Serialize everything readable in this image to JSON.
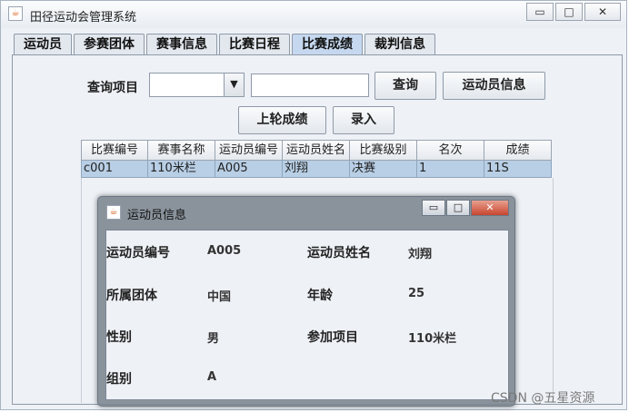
{
  "window": {
    "title": "田径运动会管理系统",
    "icon": "java-cup-icon"
  },
  "window_controls": {
    "minimize": "▭",
    "maximize": "□",
    "close": "✕"
  },
  "tabs": [
    {
      "label": "运动员"
    },
    {
      "label": "参赛团体"
    },
    {
      "label": "赛事信息"
    },
    {
      "label": "比赛日程"
    },
    {
      "label": "比赛成绩",
      "active": true
    },
    {
      "label": "裁判信息"
    }
  ],
  "query": {
    "label": "查询项目",
    "combo_value": "",
    "text_value": "",
    "query_button": "查询",
    "athlete_info_button": "运动员信息",
    "prev_round_button": "上轮成绩",
    "enter_button": "录入"
  },
  "table": {
    "columns": [
      "比赛编号",
      "赛事名称",
      "运动员编号",
      "运动员姓名",
      "比赛级别",
      "名次",
      "成绩"
    ],
    "rows": [
      [
        "c001",
        "110米栏",
        "A005",
        "刘翔",
        "决赛",
        "1",
        "11S"
      ]
    ]
  },
  "dialog": {
    "title": "运动员信息",
    "fields": {
      "athlete_id_label": "运动员编号",
      "athlete_id_value": "A005",
      "athlete_name_label": "运动员姓名",
      "athlete_name_value": "刘翔",
      "team_label": "所属团体",
      "team_value": "中国",
      "age_label": "年龄",
      "age_value": "25",
      "gender_label": "性别",
      "gender_value": "男",
      "event_label": "参加项目",
      "event_value": "110米栏",
      "group_label": "组别",
      "group_value": "A"
    }
  },
  "watermark": "CSDN @五星资源",
  "colors": {
    "selected_row": "#b8cfe5",
    "active_tab": "#c5d8ef",
    "dialog_close": "#c8452f"
  }
}
